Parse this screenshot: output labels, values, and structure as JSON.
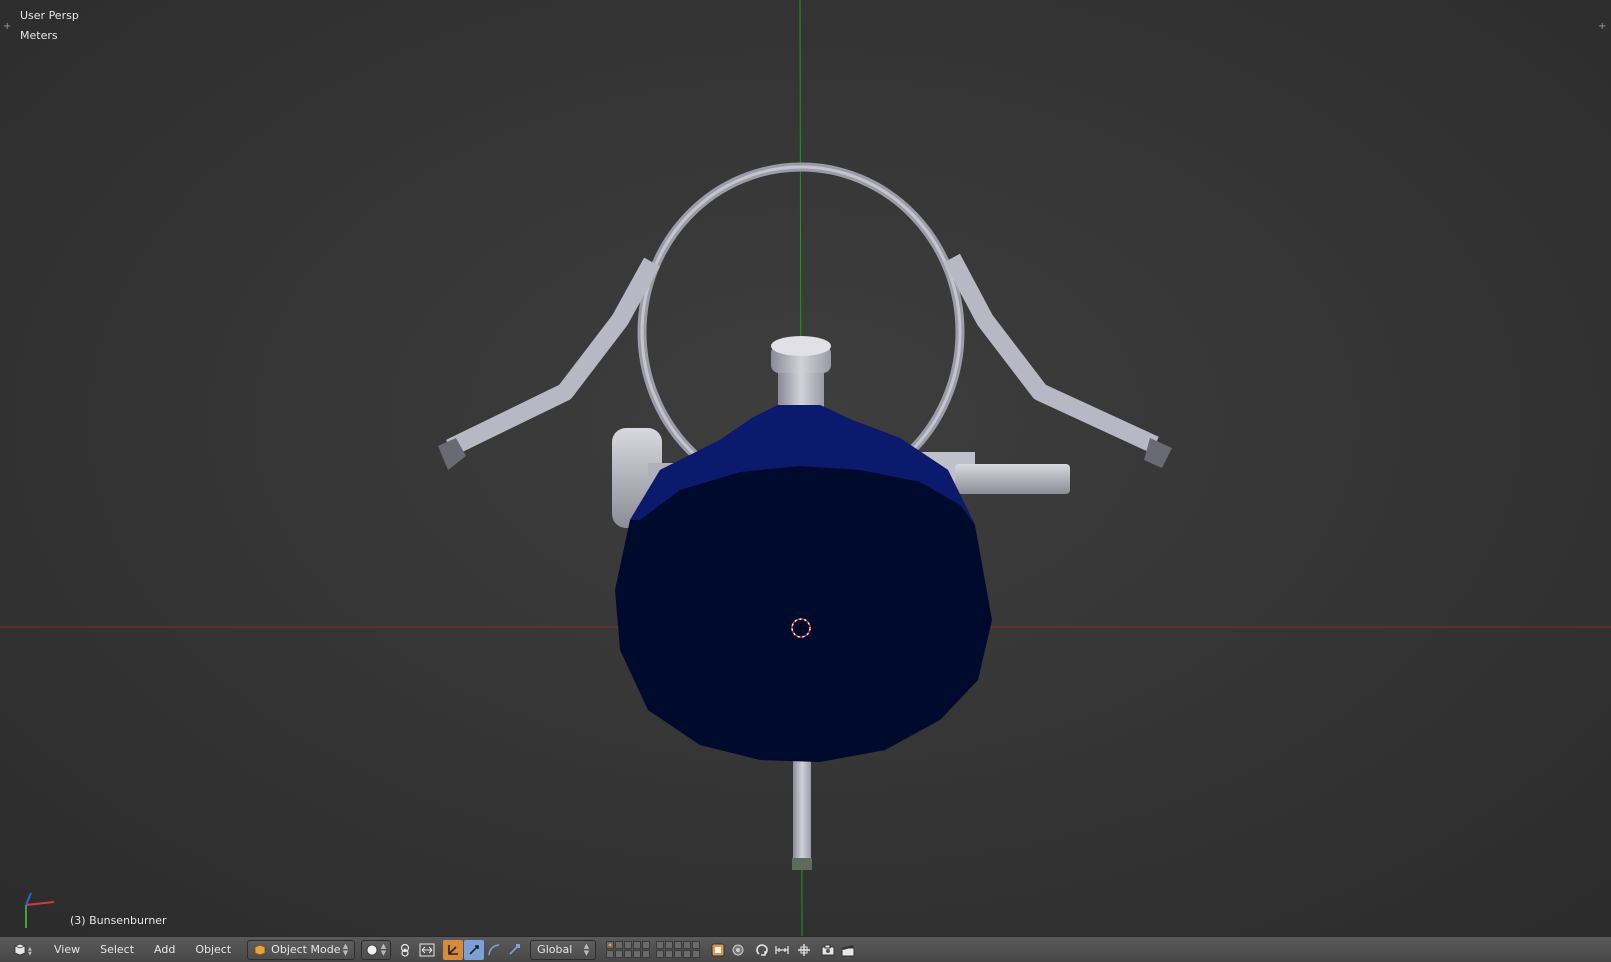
{
  "viewport": {
    "view_name": "User Persp",
    "units": "Meters",
    "active_object": "(3) Bunsenburner",
    "background_color": "#393939",
    "axis_x_color": "#b22a2a",
    "axis_y_color": "#2aa62a",
    "object_color": "#00083a",
    "metal_color": "#b4b4be"
  },
  "header": {
    "editor_type_icon": "cube-icon",
    "menus": {
      "view": "View",
      "select": "Select",
      "add": "Add",
      "object": "Object"
    },
    "mode": "Object Mode",
    "transform_orientation": "Global"
  }
}
